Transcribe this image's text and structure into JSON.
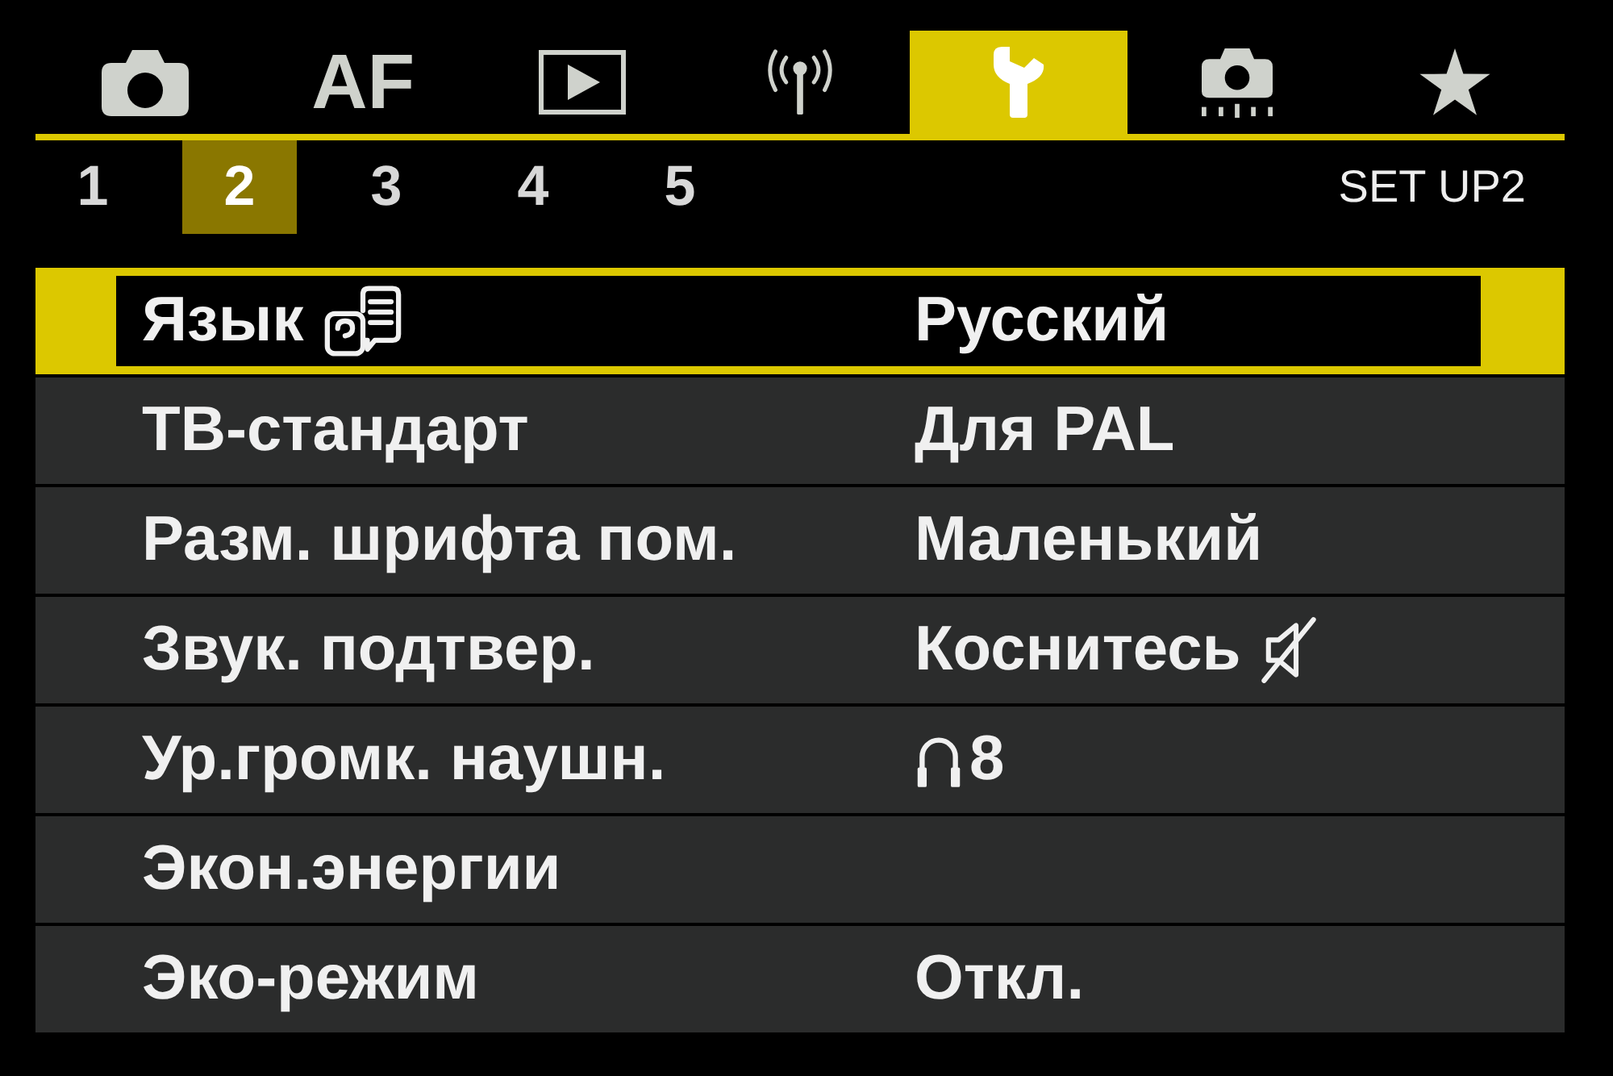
{
  "tabs": [
    {
      "kind": "shooting",
      "selected": false
    },
    {
      "kind": "text",
      "label": "AF",
      "selected": false
    },
    {
      "kind": "playback",
      "selected": false
    },
    {
      "kind": "wireless",
      "selected": false
    },
    {
      "kind": "setup",
      "selected": true
    },
    {
      "kind": "custom",
      "selected": false
    },
    {
      "kind": "mymenu",
      "selected": false
    }
  ],
  "pages": [
    {
      "label": "1",
      "selected": false
    },
    {
      "label": "2",
      "selected": true
    },
    {
      "label": "3",
      "selected": false
    },
    {
      "label": "4",
      "selected": false
    },
    {
      "label": "5",
      "selected": false
    }
  ],
  "page_title": "SET UP2",
  "menu": [
    {
      "label": [
        {
          "kind": "text",
          "text": "Язык"
        },
        {
          "kind": "language"
        }
      ],
      "value": [
        {
          "kind": "text",
          "text": "Русский"
        }
      ],
      "selected": true
    },
    {
      "label": [
        {
          "kind": "text",
          "text": "ТВ-стандарт"
        }
      ],
      "value": [
        {
          "kind": "text",
          "text": "Для PAL"
        }
      ],
      "selected": false
    },
    {
      "label": [
        {
          "kind": "text",
          "text": "Разм. шрифта пом."
        }
      ],
      "value": [
        {
          "kind": "text",
          "text": "Маленький"
        }
      ],
      "selected": false
    },
    {
      "label": [
        {
          "kind": "text",
          "text": "Звук. подтвер."
        }
      ],
      "value": [
        {
          "kind": "text",
          "text": "Коснитесь"
        },
        {
          "kind": "mute"
        }
      ],
      "selected": false
    },
    {
      "label": [
        {
          "kind": "text",
          "text": "Ур.громк. наушн."
        }
      ],
      "value": [
        {
          "kind": "headphones"
        },
        {
          "kind": "text",
          "text": "8"
        }
      ],
      "selected": false
    },
    {
      "label": [
        {
          "kind": "text",
          "text": "Экон.энергии"
        }
      ],
      "selected": false
    },
    {
      "label": [
        {
          "kind": "text",
          "text": "Эко-режим"
        }
      ],
      "value": [
        {
          "kind": "text",
          "text": "Откл."
        }
      ],
      "selected": false
    }
  ]
}
